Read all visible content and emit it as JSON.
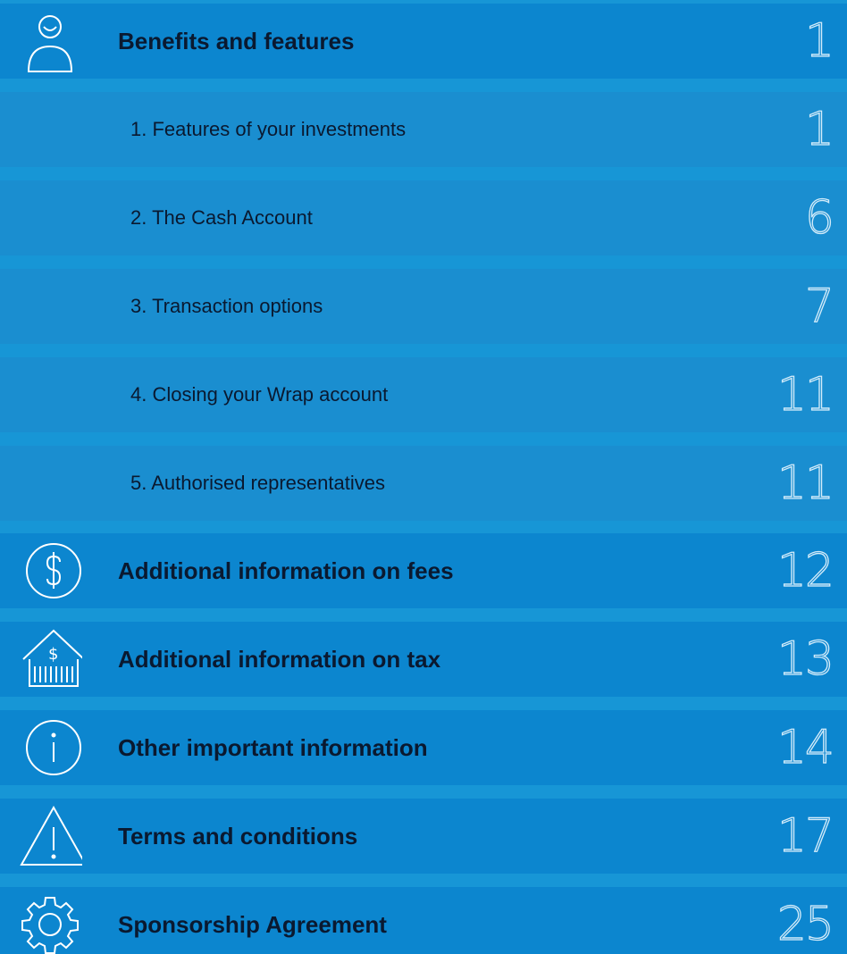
{
  "toc": {
    "entries": [
      {
        "label": "Benefits and features",
        "page": "1",
        "level": "main",
        "icon": "person-icon"
      },
      {
        "label": "1. Features of your investments",
        "page": "1",
        "level": "sub"
      },
      {
        "label": "2. The Cash Account",
        "page": "6",
        "level": "sub"
      },
      {
        "label": "3. Transaction options",
        "page": "7",
        "level": "sub"
      },
      {
        "label": "4. Closing your Wrap account",
        "page": "11",
        "level": "sub"
      },
      {
        "label": "5. Authorised representatives",
        "page": "11",
        "level": "sub"
      },
      {
        "label": "Additional information on fees",
        "page": "12",
        "level": "main",
        "icon": "dollar-circle-icon"
      },
      {
        "label": "Additional information on tax",
        "page": "13",
        "level": "main",
        "icon": "tax-house-icon"
      },
      {
        "label": "Other important information",
        "page": "14",
        "level": "main",
        "icon": "info-circle-icon"
      },
      {
        "label": "Terms and conditions",
        "page": "17",
        "level": "main",
        "icon": "warning-triangle-icon"
      },
      {
        "label": "Sponsorship Agreement",
        "page": "25",
        "level": "main",
        "icon": "gear-icon"
      }
    ]
  },
  "colors": {
    "background": "#1796d6",
    "main_row": "#0c86cf",
    "sub_row": "#1a8ed0",
    "label_text": "#0a1930",
    "page_number": "#d4ecfa"
  }
}
